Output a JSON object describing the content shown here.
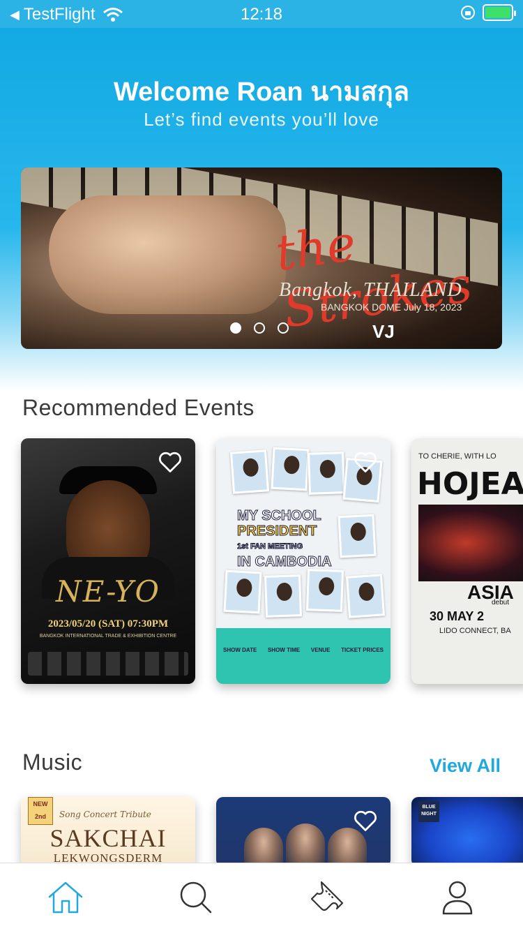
{
  "status_bar": {
    "back_app": "TestFlight",
    "time": "12:18"
  },
  "header": {
    "welcome": "Welcome Roan นามสกุล",
    "subtitle": "Let’s find events you’ll love"
  },
  "banner": {
    "script_text": "the Strokes",
    "city_text": "Bangkok, THAILAND",
    "date_text": "BANGKOK DOME July 18, 2023",
    "page_count": 3,
    "active_page": 1
  },
  "recommended": {
    "title": "Recommended Events",
    "cards": [
      {
        "name": "ne-yo",
        "title": "NE-YO",
        "date": "2023/05/20 (SAT) 07:30PM",
        "venue": "BANGKOK INTERNATIONAL TRADE & EXHIBITION CENTRE"
      },
      {
        "name": "my-school-president",
        "title_line1": "MY SCHOOL",
        "title_line2": "PRESIDENT",
        "title_line3": "1st FAN MEETING",
        "title_line4": "IN CAMBODIA",
        "info": [
          "SHOW DATE",
          "SHOW TIME",
          "VENUE",
          "TICKET PRICES"
        ]
      },
      {
        "name": "hojean",
        "top_text": "TO CHERIE, WITH LO",
        "title": "HOJEA",
        "asia": "ASIA",
        "debut": "debut",
        "date": "30 MAY 2",
        "venue": "LIDO CONNECT, BA"
      }
    ]
  },
  "music": {
    "title": "Music",
    "view_all": "View All",
    "cards": [
      {
        "name": "sakchai",
        "badge_line1": "NEW",
        "badge_line2": "2nd",
        "script": "Song Concert Tribute",
        "title": "SAKCHAI",
        "subtitle": "LEKWONGSDERM"
      },
      {
        "name": "band-poster"
      },
      {
        "name": "blue-poster",
        "tag": "BLUE NIGHT"
      }
    ]
  },
  "tabbar": {
    "tabs": [
      "home",
      "search",
      "tickets",
      "profile"
    ],
    "active": "home",
    "active_color": "#21a9dd",
    "inactive_color": "#333333"
  }
}
